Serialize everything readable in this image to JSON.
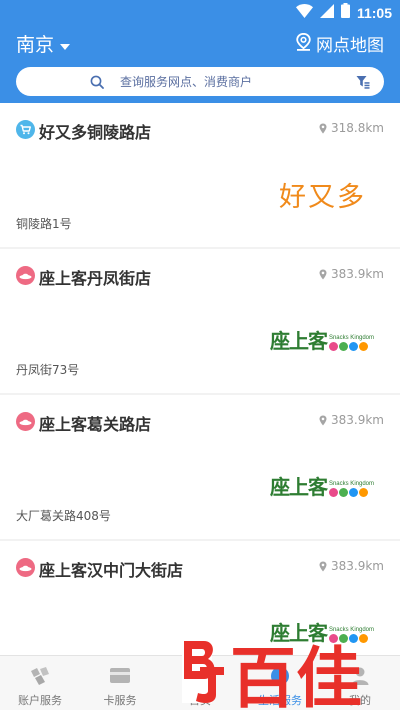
{
  "status": {
    "time": "11:05"
  },
  "header": {
    "city": "南京",
    "map_link": "网点地图",
    "search_placeholder": "查询服务网点、消费商户"
  },
  "stores": [
    {
      "name": "好又多铜陵路店",
      "distance": "318.8km",
      "address": "铜陵路1号",
      "logo_text": "好又多",
      "icon": "shopping-cart-icon",
      "icon_color": "#4fb6ea"
    },
    {
      "name": "座上客丹凤街店",
      "distance": "383.9km",
      "address": "丹凤街73号",
      "logo_text": "座上客",
      "logo_sub": "Snacks Kingdom",
      "icon": "hat-icon",
      "icon_color": "#ee6a83"
    },
    {
      "name": "座上客葛关路店",
      "distance": "383.9km",
      "address": "大厂葛关路408号",
      "logo_text": "座上客",
      "logo_sub": "Snacks Kingdom",
      "icon": "hat-icon",
      "icon_color": "#ee6a83"
    },
    {
      "name": "座上客汉中门大街店",
      "distance": "383.9km",
      "address": "",
      "logo_text": "座上客",
      "logo_sub": "Snacks Kingdom",
      "icon": "hat-icon",
      "icon_color": "#ee6a83"
    }
  ],
  "tabs": [
    {
      "label": "账户服务",
      "icon": "account-service-icon"
    },
    {
      "label": "卡服务",
      "icon": "card-service-icon"
    },
    {
      "label": "首页",
      "icon": "home-icon"
    },
    {
      "label": "生活服务",
      "icon": "life-service-icon",
      "active": true
    },
    {
      "label": "我的",
      "icon": "profile-icon"
    }
  ],
  "watermark": {
    "text": "百佳",
    "logo_letters": "BJ"
  },
  "colors": {
    "primary": "#3b8fe6",
    "watermark_red": "#e8302a"
  }
}
